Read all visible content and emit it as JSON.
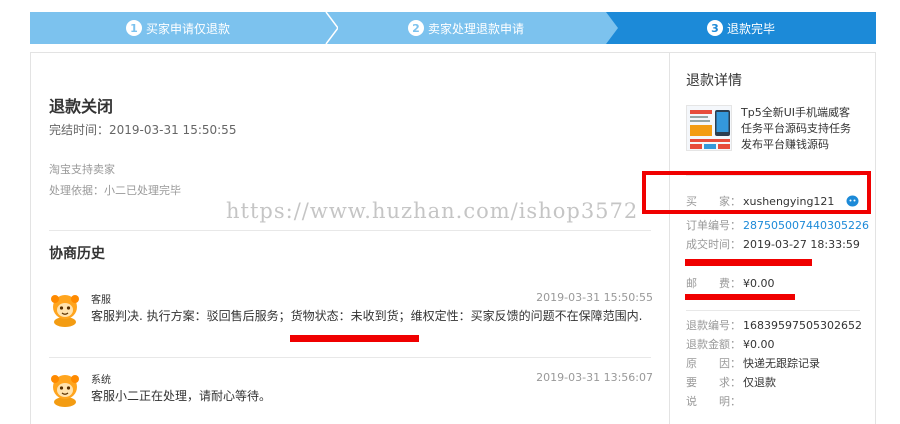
{
  "steps": [
    {
      "number": "1",
      "label": "买家申请仅退款"
    },
    {
      "number": "2",
      "label": "卖家处理退款申请"
    },
    {
      "number": "3",
      "label": "退款完毕"
    }
  ],
  "status": {
    "title": "退款关闭",
    "finish_time": "完结时间：2019-03-31 15:50:55",
    "support": "淘宝支持卖家",
    "basis": "处理依据：小二已处理完毕"
  },
  "history": {
    "title": "协商历史",
    "messages": [
      {
        "who": "客服",
        "time": "2019-03-31 15:50:55",
        "text": "客服判决. 执行方案：驳回售后服务；货物状态：未收到货；维权定性：买家反馈的问题不在保障范围内."
      },
      {
        "who": "系统",
        "time": "2019-03-31 13:56:07",
        "text": "客服小二正在处理，请耐心等待。"
      }
    ]
  },
  "refund_detail": {
    "title": "退款详情",
    "product_name": "Tp5全新UI手机端威客任务平台源码支持任务发布平台赚钱源码",
    "buyer_label": "买　　家：",
    "buyer_value": "xushengying121",
    "order_label": "订单编号：",
    "order_value": "287505007440305226",
    "deal_label": "成交时间：",
    "deal_value": "2019-03-27 18:33:59",
    "postage_label": "邮　　费：",
    "postage_value": "¥0.00",
    "refund_no_label": "退款编号：",
    "refund_no_value": "16839597505302652",
    "refund_amount_label": "退款金额：",
    "refund_amount_value": "¥0.00",
    "reason_label": "原　　因：",
    "reason_value": "快递无跟踪记录",
    "request_label": "要　　求：",
    "request_value": "仅退款",
    "explain_label": "说　　明：",
    "explain_value": ""
  },
  "watermark": "https://www.huzhan.com/ishop3572",
  "colors": {
    "step_inactive": "#7cc2ee",
    "step_active": "#1c8ad8",
    "link": "#1c8ad8",
    "annotation_red": "#f00000"
  },
  "icons": {
    "avatar": "orange-mascot-avatar",
    "buyer_chat": "aliwangwang-chat-icon",
    "step_separator": "chevron-right-icon"
  }
}
